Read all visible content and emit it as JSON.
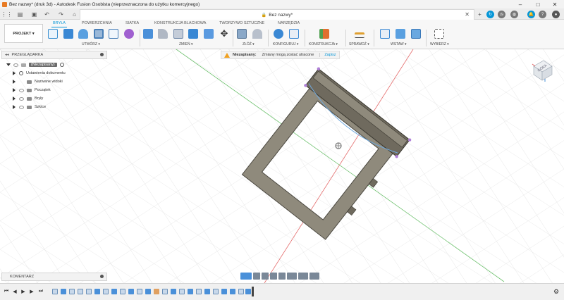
{
  "window": {
    "title": "Bez nazwy* (druk 3d) - Autodesk Fusion Osobista (nieprzeznaczona do użytku komercyjnego)"
  },
  "document_tab": {
    "label": "Bez nazwy*"
  },
  "ribbon": {
    "project_label": "PROJEKT",
    "tabs": [
      {
        "label": "BRYŁA",
        "active": true
      },
      {
        "label": "POWIERZCHNIA",
        "active": false
      },
      {
        "label": "SIATKA",
        "active": false
      },
      {
        "label": "KONSTRUKCJA BLACHOWA",
        "active": false
      },
      {
        "label": "TWORZYWO SZTUCZNE",
        "active": false
      },
      {
        "label": "NARZĘDZIA",
        "active": false
      }
    ],
    "groups": [
      {
        "label": "UTWÓRZ ▾"
      },
      {
        "label": "ZMIEŃ ▾"
      },
      {
        "label": "ZŁÓŻ ▾"
      },
      {
        "label": "KONFIGURUJ ▾"
      },
      {
        "label": "KONSTRUKCJA ▾"
      },
      {
        "label": "SPRAWDŹ ▾"
      },
      {
        "label": "WSTAW ▾"
      },
      {
        "label": "WYBIERZ ▾"
      }
    ],
    "accent_color": "#0696d7"
  },
  "browser": {
    "title": "PRZEGLĄDARKA",
    "root": "(Niezapisany)",
    "items": [
      {
        "label": "Ustawienia dokumentu",
        "icon": "gear-icon"
      },
      {
        "label": "Nazwane widoki",
        "icon": "folder-icon"
      },
      {
        "label": "Początek",
        "icon": "folder-icon"
      },
      {
        "label": "Bryły",
        "icon": "folder-icon"
      },
      {
        "label": "Szkice",
        "icon": "folder-icon"
      }
    ]
  },
  "warning": {
    "title": "Niezapisany:",
    "message": "Zmiany mogą zostać utracone",
    "action": "Zapisz"
  },
  "viewcube": {
    "face_label": "GÓRA"
  },
  "comments": {
    "title": "KOMENTARZ"
  },
  "colors": {
    "body": "#8f8a7c",
    "body_dark": "#6f6a5e",
    "sketch_blue": "#6fa8dc",
    "axis_red": "#e46a6a",
    "axis_green": "#6cc06c"
  }
}
